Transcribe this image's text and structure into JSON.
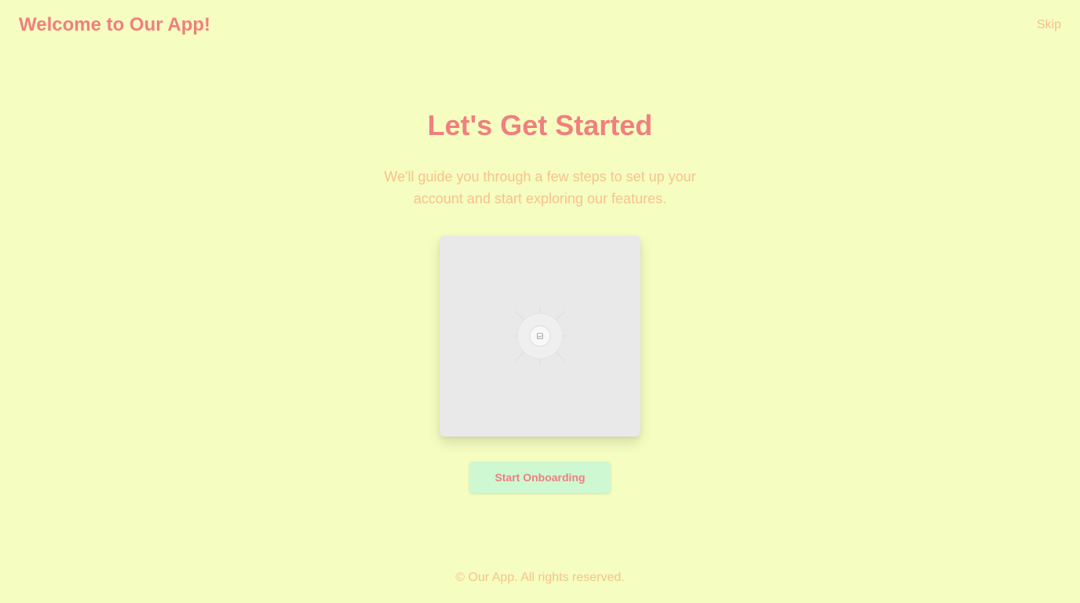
{
  "header": {
    "app_title": "Welcome to Our App!",
    "skip_label": "Skip"
  },
  "main": {
    "headline": "Let's Get Started",
    "subtitle": "We'll guide you through a few steps to set up your account and start exploring our features.",
    "illustration_icon": "image-placeholder-icon",
    "cta_label": "Start Onboarding"
  },
  "footer": {
    "copyright": "© Our App. All rights reserved."
  },
  "colors": {
    "background": "#f5fdc0",
    "primary_text": "#f07f7f",
    "secondary_text": "#f6c28f",
    "button_bg": "#cdf8d2",
    "placeholder_bg": "#e9e9e9"
  }
}
